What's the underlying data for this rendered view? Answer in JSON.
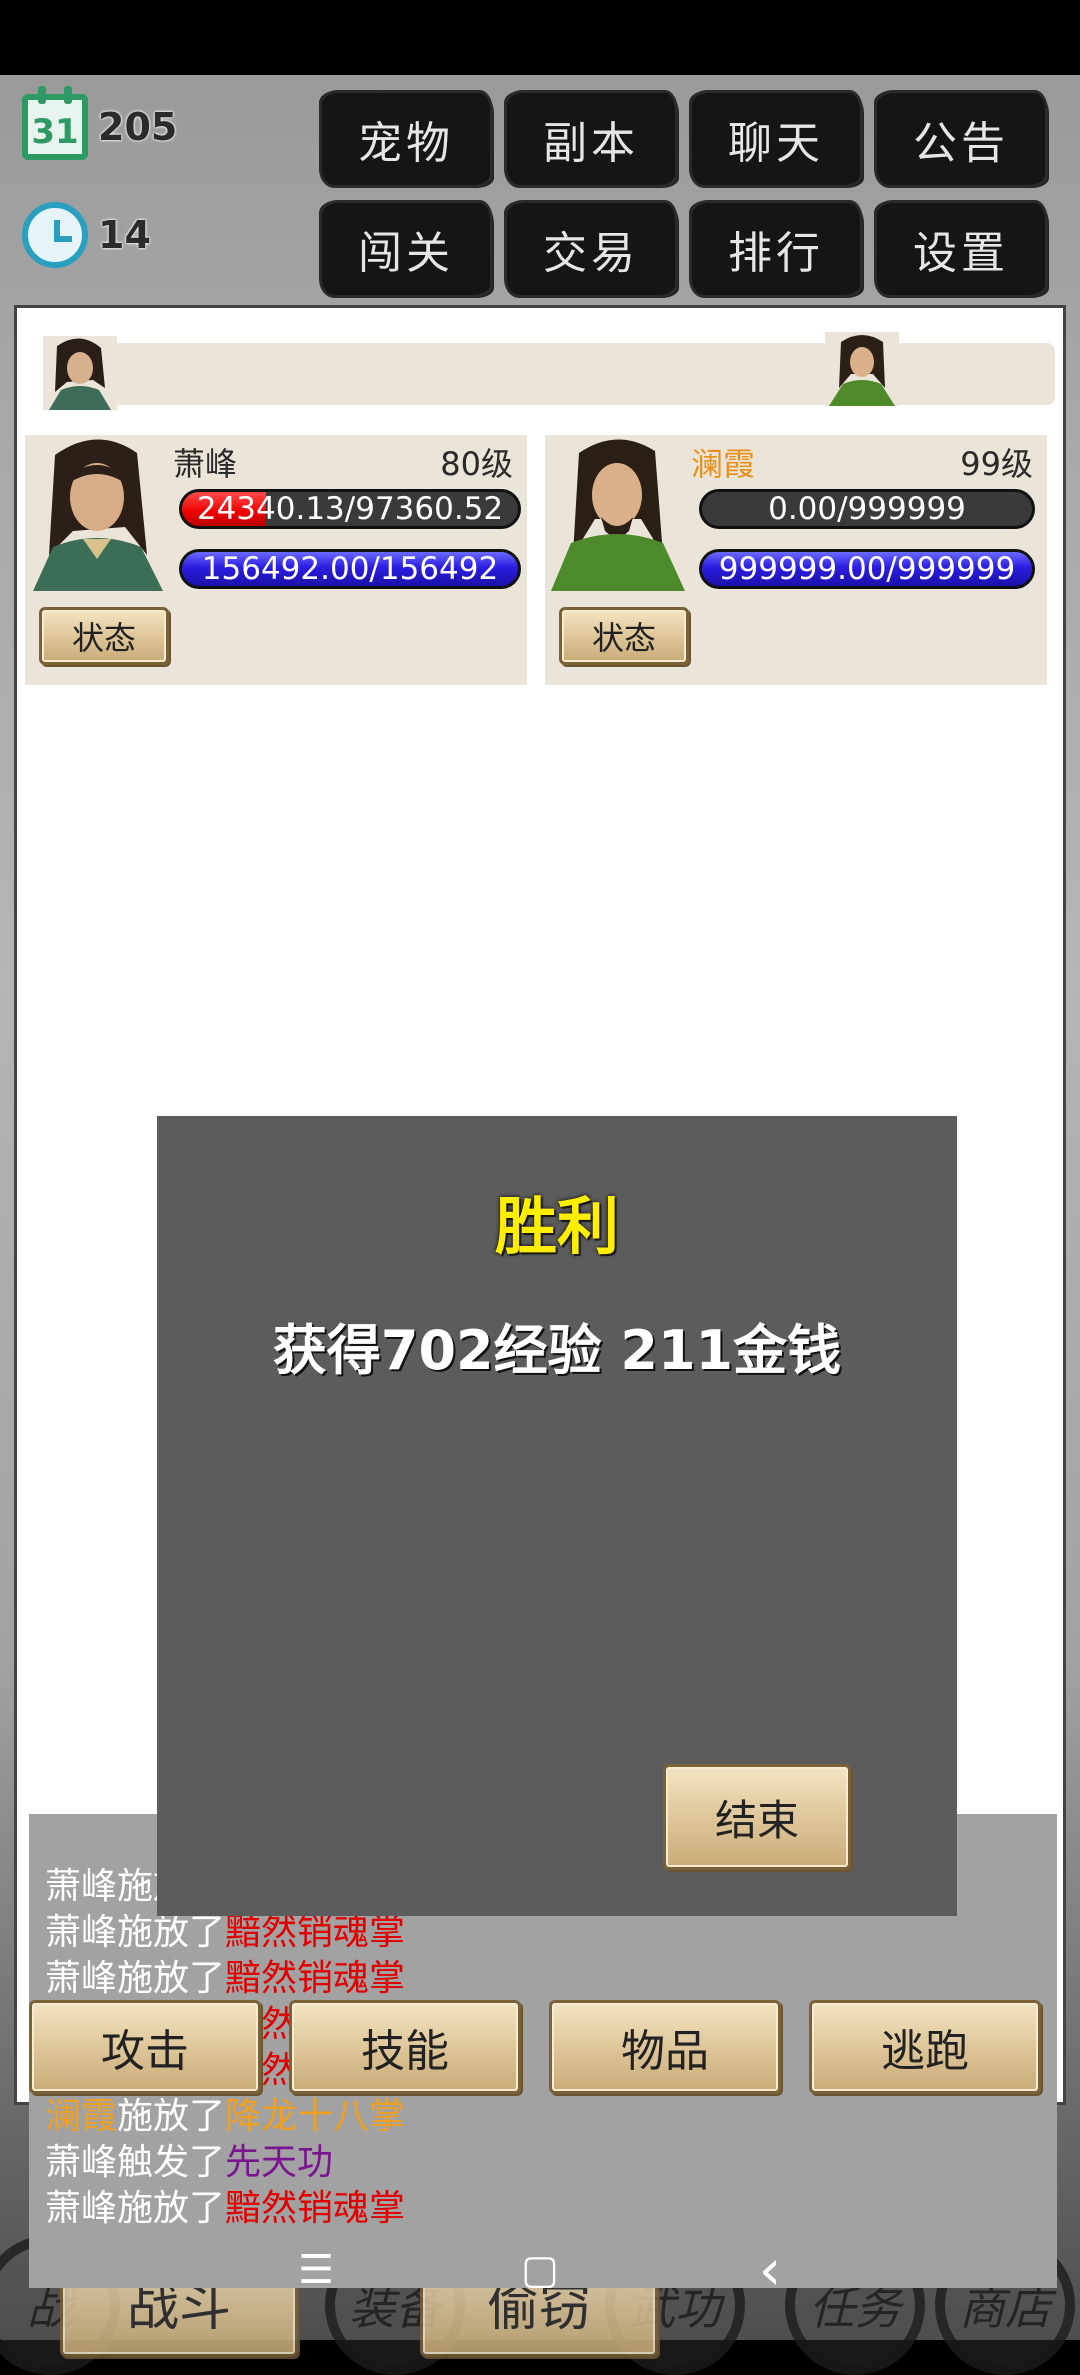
{
  "status": {
    "calendar_day_icon_text": "31",
    "days": "205",
    "alarm": "14"
  },
  "menu_row1": [
    "宠物",
    "副本",
    "聊天",
    "公告"
  ],
  "menu_row2": [
    "闯关",
    "交易",
    "排行",
    "设置"
  ],
  "player": {
    "name": "萧峰",
    "level": "80级",
    "hp": "24340.13/97360.52",
    "hp_fraction": 0.25,
    "mp": "156492.00/156492",
    "status_label": "状态"
  },
  "enemy": {
    "name": "澜霞",
    "level": "99级",
    "hp": "0.00/999999",
    "hp_fraction": 0,
    "mp": "999999.00/999999",
    "status_label": "状态"
  },
  "victory": {
    "title": "胜利",
    "reward": "获得702经验 211金钱",
    "end_label": "结束"
  },
  "log": [
    {
      "actor": "萧峰",
      "verb": "施放了",
      "skill": "黯然销魂掌",
      "actor_color": "#ffffff",
      "skill_color": "#e00000"
    },
    {
      "actor": "萧峰",
      "verb": "施放了",
      "skill": "黯然销魂掌",
      "actor_color": "#ffffff",
      "skill_color": "#e00000"
    },
    {
      "actor": "萧峰",
      "verb": "施放了",
      "skill": "黯然销魂掌",
      "actor_color": "#ffffff",
      "skill_color": "#e00000"
    },
    {
      "actor": "萧峰",
      "verb": "施放了",
      "skill": "黯然销魂掌",
      "actor_color": "#ffffff",
      "skill_color": "#e00000"
    },
    {
      "actor": "萧峰",
      "verb": "施放了",
      "skill": "黯然销魂掌",
      "actor_color": "#ffffff",
      "skill_color": "#e00000"
    },
    {
      "actor": "澜霞",
      "verb": "施放了",
      "skill": "降龙十八掌",
      "actor_color": "#f0a020",
      "skill_color": "#f0a020"
    },
    {
      "actor": "萧峰",
      "verb": "触发了",
      "skill": "先天功",
      "actor_color": "#ffffff",
      "skill_color": "#7a1590"
    },
    {
      "actor": "萧峰",
      "verb": "施放了",
      "skill": "黯然销魂掌",
      "actor_color": "#ffffff",
      "skill_color": "#e00000"
    }
  ],
  "actions": [
    "攻击",
    "技能",
    "物品",
    "逃跑"
  ],
  "bottom": {
    "fight": "战斗",
    "steal": "偷窃",
    "bg_nav": [
      "战",
      "装备",
      "武功",
      "任务",
      "商店"
    ]
  },
  "sysnav": {
    "menu": "☰",
    "home": "▢",
    "back": "‹"
  }
}
